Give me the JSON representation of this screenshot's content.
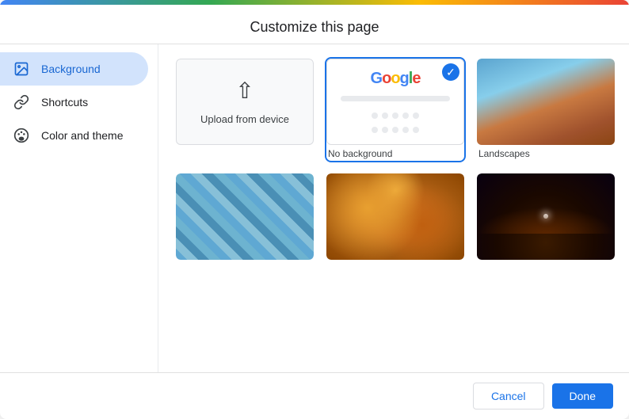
{
  "dialog": {
    "title": "Customize this page",
    "cancel_label": "Cancel",
    "done_label": "Done"
  },
  "sidebar": {
    "items": [
      {
        "id": "background",
        "label": "Background",
        "icon": "image-icon",
        "active": true
      },
      {
        "id": "shortcuts",
        "label": "Shortcuts",
        "icon": "link-icon",
        "active": false
      },
      {
        "id": "color-theme",
        "label": "Color and theme",
        "icon": "palette-icon",
        "active": false
      }
    ]
  },
  "grid": {
    "tiles": [
      {
        "id": "upload",
        "type": "upload",
        "label": "Upload from device",
        "selected": false
      },
      {
        "id": "no-background",
        "type": "no-bg",
        "label": "No background",
        "selected": true
      },
      {
        "id": "landscapes",
        "type": "image",
        "label": "Landscapes",
        "selected": false
      },
      {
        "id": "buildings",
        "type": "image",
        "label": "",
        "selected": false
      },
      {
        "id": "autumn",
        "type": "image",
        "label": "",
        "selected": false
      },
      {
        "id": "space",
        "type": "image",
        "label": "",
        "selected": false
      }
    ]
  },
  "google_logo": {
    "letters": [
      {
        "char": "G",
        "color": "#4285F4"
      },
      {
        "char": "o",
        "color": "#EA4335"
      },
      {
        "char": "o",
        "color": "#FBBC04"
      },
      {
        "char": "g",
        "color": "#4285F4"
      },
      {
        "char": "l",
        "color": "#34A853"
      },
      {
        "char": "e",
        "color": "#EA4335"
      }
    ]
  }
}
